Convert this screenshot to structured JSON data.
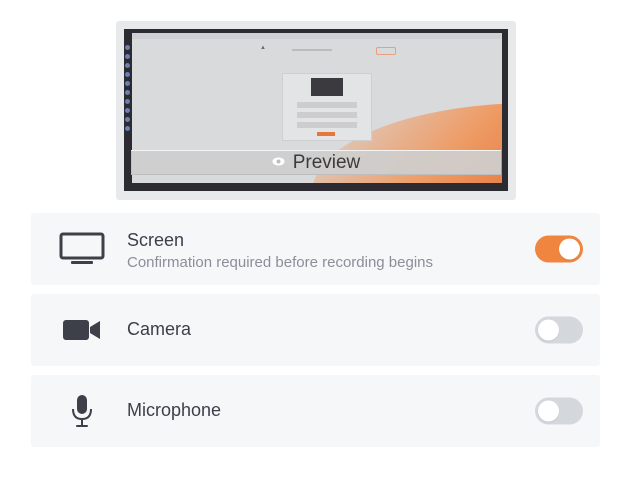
{
  "preview": {
    "label": "Preview",
    "icon": "eye-icon"
  },
  "options": {
    "screen": {
      "title": "Screen",
      "subtitle": "Confirmation required before recording begins",
      "enabled": true,
      "icon": "monitor-icon"
    },
    "camera": {
      "title": "Camera",
      "enabled": false,
      "icon": "video-camera-icon"
    },
    "microphone": {
      "title": "Microphone",
      "enabled": false,
      "icon": "microphone-icon"
    }
  },
  "colors": {
    "accent": "#f0853f",
    "toggle_off": "#d4d7dc",
    "row_bg": "#f6f7f8",
    "text_primary": "#3a3f4a",
    "text_secondary": "#8a8f98",
    "icon": "#3d4048"
  }
}
